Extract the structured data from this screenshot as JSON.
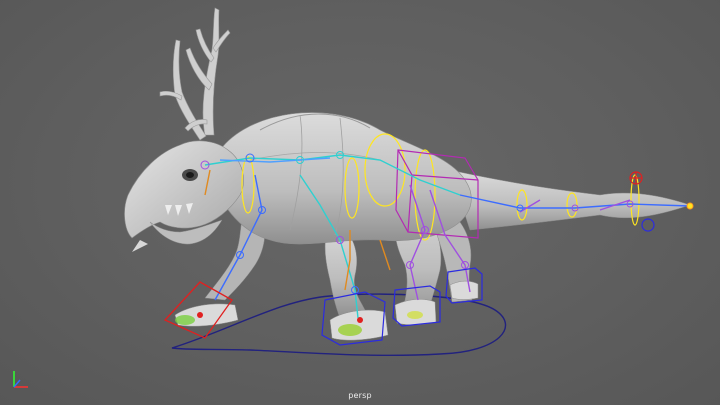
{
  "viewport": {
    "camera_label": "persp",
    "background": "#5f5f5f"
  },
  "scene": {
    "model": "antlered-quadruped-creature",
    "colors": {
      "mesh": "#c9c9c9",
      "mesh_shadow": "#9a9a9a",
      "spine_controls": "#ffe620",
      "chest_box": "#b32bb3",
      "foot_controls": "#2b2be0",
      "ik_red": "#e02020",
      "motion_path": "#1e1e7a",
      "bones_cyan": "#2fd0d0",
      "bones_blue": "#3c6cff",
      "bones_purple": "#a050e0",
      "bones_orange": "#e08a20",
      "bones_green": "#40d040"
    }
  },
  "axis_gizmo": {
    "icon": "xyz-axis-icon",
    "x_color": "#ff3030",
    "y_color": "#30ff30",
    "z_color": "#3070ff"
  }
}
